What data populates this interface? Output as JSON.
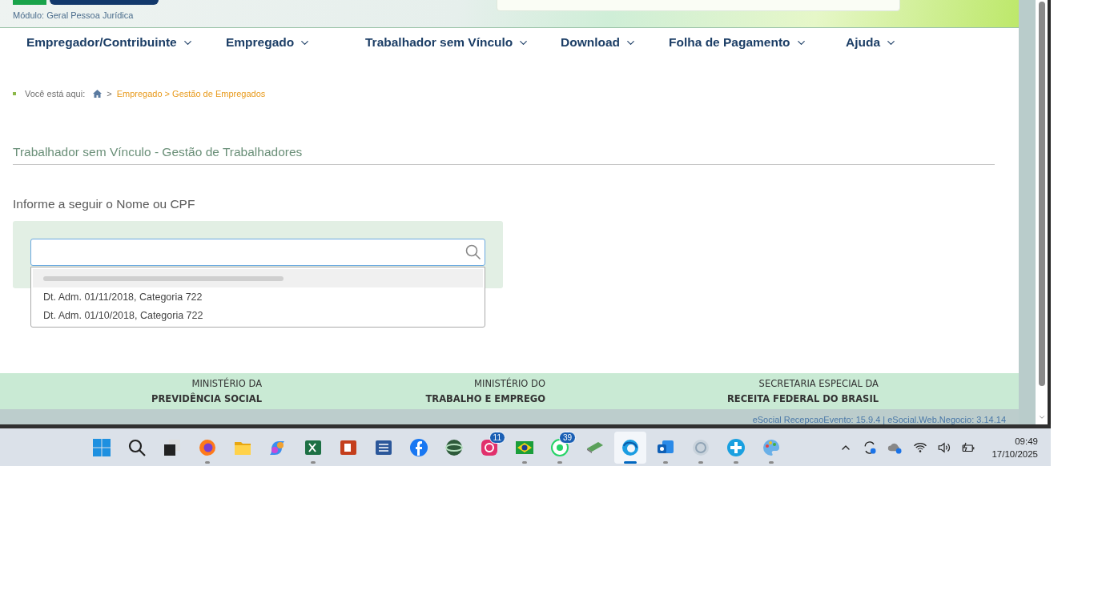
{
  "header": {
    "module": "Módulo: Geral Pessoa Jurídica"
  },
  "nav": [
    {
      "label": "Empregador/Contribuinte"
    },
    {
      "label": "Empregado"
    },
    {
      "label": "Trabalhador sem Vínculo"
    },
    {
      "label": "Download"
    },
    {
      "label": "Folha de Pagamento"
    },
    {
      "label": "Ajuda"
    }
  ],
  "breadcrumb": {
    "label": "Você está aqui:",
    "separator": ">",
    "path": "Empregado > Gestão de Empregados"
  },
  "page_title": "Trabalhador sem Vínculo - Gestão de Trabalhadores",
  "search": {
    "label": "Informe a seguir o Nome ou CPF",
    "suggestions": [
      {
        "kind": "redacted",
        "selected": true
      },
      {
        "kind": "text",
        "text": "Dt. Adm. 01/11/2018, Categoria 722",
        "selected": false
      },
      {
        "kind": "text",
        "text": "Dt. Adm. 01/10/2018, Categoria 722",
        "selected": false
      }
    ]
  },
  "footer": [
    {
      "line1": "MINISTÉRIO DA",
      "line2": "PREVIDÊNCIA SOCIAL"
    },
    {
      "line1": "MINISTÉRIO DO",
      "line2": "TRABALHO E EMPREGO"
    },
    {
      "line1": "SECRETARIA ESPECIAL DA",
      "line2": "RECEITA FEDERAL DO BRASIL"
    }
  ],
  "version": "eSocial RecepcaoEvento: 15.9.4 | eSocial.Web.Negocio: 3.14.14",
  "taskbar": {
    "apps": [
      {
        "kind": "start",
        "running": false,
        "selected": false
      },
      {
        "kind": "search",
        "running": false,
        "selected": false
      },
      {
        "kind": "taskview",
        "running": false,
        "selected": false
      },
      {
        "kind": "firefox",
        "running": true,
        "selected": false
      },
      {
        "kind": "folder",
        "running": false,
        "selected": false
      },
      {
        "kind": "copilot",
        "running": false,
        "selected": false
      },
      {
        "kind": "excel",
        "running": true,
        "selected": false
      },
      {
        "kind": "powerpoint",
        "running": false,
        "selected": false
      },
      {
        "kind": "word",
        "running": false,
        "selected": false
      },
      {
        "kind": "facebook",
        "running": false,
        "selected": false
      },
      {
        "kind": "globe",
        "running": false,
        "selected": false
      },
      {
        "kind": "instagram",
        "running": false,
        "selected": false,
        "badge": "11"
      },
      {
        "kind": "flag",
        "running": true,
        "selected": false
      },
      {
        "kind": "whatsapp",
        "running": true,
        "selected": false,
        "badge": "39"
      },
      {
        "kind": "card",
        "running": false,
        "selected": false
      },
      {
        "kind": "edge",
        "running": true,
        "selected": true
      },
      {
        "kind": "outlook",
        "running": true,
        "selected": false
      },
      {
        "kind": "ring",
        "running": true,
        "selected": false
      },
      {
        "kind": "plus",
        "running": true,
        "selected": false
      },
      {
        "kind": "palette",
        "running": true,
        "selected": false
      }
    ],
    "time": "09:49",
    "date": "17/10/2025"
  }
}
